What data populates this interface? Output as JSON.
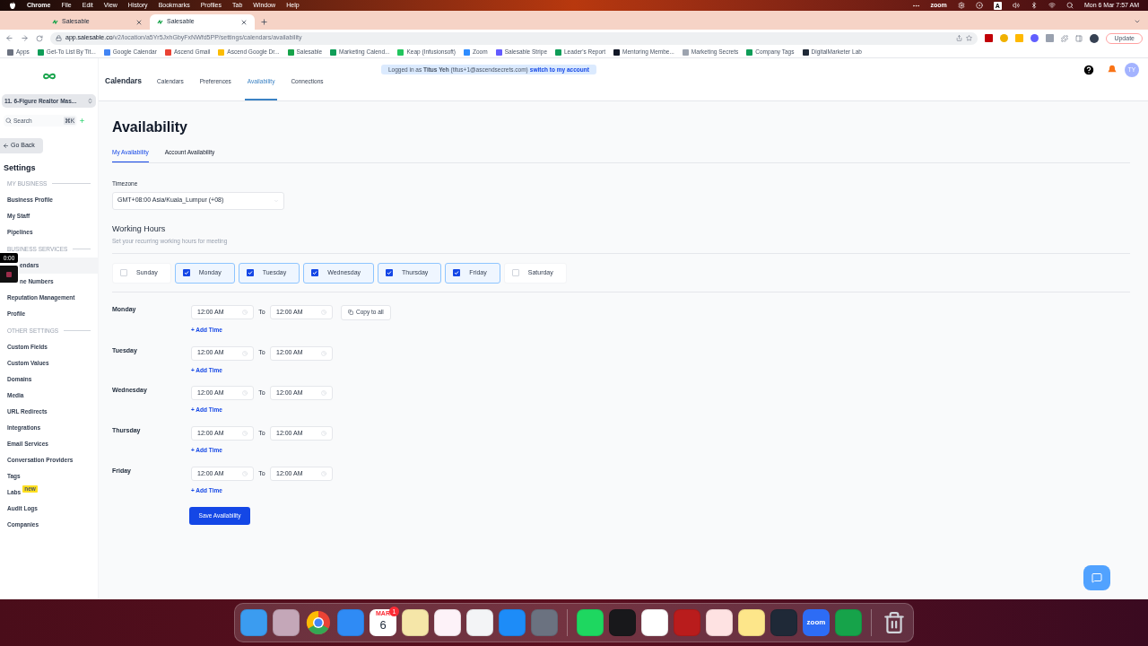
{
  "menubar": {
    "app": "Chrome",
    "menus": [
      "File",
      "Edit",
      "View",
      "History",
      "Bookmarks",
      "Profiles",
      "Tab",
      "Window",
      "Help"
    ],
    "zoom": "zoom",
    "input_source": "A",
    "clock": "Mon 6 Mar 7:57 AM"
  },
  "browser": {
    "tabs": [
      {
        "title": "Salesable",
        "selected": false
      },
      {
        "title": "Salesable",
        "selected": true
      }
    ],
    "url_host": "app.salesable.co",
    "url_path": "/v2/location/a5Yr5JxhGbyFxNWfd5PP/settings/calendars/availability",
    "update": "Update",
    "bookmarks": [
      {
        "label": "Apps",
        "color": "#6b7280"
      },
      {
        "label": "Get-To List By Tit...",
        "color": "#0f9d58"
      },
      {
        "label": "Google Calendar",
        "color": "#4285f4"
      },
      {
        "label": "Ascend Gmail",
        "color": "#ea4335"
      },
      {
        "label": "Ascend Google Dr...",
        "color": "#fbbc04"
      },
      {
        "label": "Salesable",
        "color": "#16a34a"
      },
      {
        "label": "Marketing Calend...",
        "color": "#0f9d58"
      },
      {
        "label": "Keap (Infusionsoft)",
        "color": "#22c55e"
      },
      {
        "label": "Zoom",
        "color": "#2d8cff"
      },
      {
        "label": "Salesable Stripe",
        "color": "#635bff"
      },
      {
        "label": "Leader's Report",
        "color": "#0f9d58"
      },
      {
        "label": "Mentoring Membe...",
        "color": "#111827"
      },
      {
        "label": "Marketing Secrets",
        "color": "#9ca3af"
      },
      {
        "label": "Company Tags",
        "color": "#0f9d58"
      },
      {
        "label": "DigitalMarketer Lab",
        "color": "#1f2937"
      }
    ]
  },
  "sidebar": {
    "account": "11. 6-Figure Realtor Mas...",
    "search": {
      "placeholder": "Search"
    },
    "shortcut": "⌘K",
    "back": "Go Back",
    "title": "Settings",
    "sections": [
      {
        "heading": "MY BUSINESS",
        "items": [
          {
            "label": "Business Profile",
            "selected": false
          },
          {
            "label": "My Staff",
            "selected": false
          },
          {
            "label": "Pipelines",
            "selected": false
          }
        ]
      },
      {
        "heading": "BUSINESS SERVICES",
        "items": [
          {
            "label": "endars",
            "selected": true,
            "covered": true
          },
          {
            "label": "ne Numbers",
            "selected": false,
            "covered": true
          },
          {
            "label": "Reputation Management",
            "selected": false
          },
          {
            "label": "Profile",
            "selected": false
          }
        ]
      },
      {
        "heading": "OTHER SETTINGS",
        "items": [
          {
            "label": "Custom Fields",
            "selected": false
          },
          {
            "label": "Custom Values",
            "selected": false
          },
          {
            "label": "Domains",
            "selected": false
          },
          {
            "label": "Media",
            "selected": false
          },
          {
            "label": "URL Redirects",
            "selected": false
          },
          {
            "label": "Integrations",
            "selected": false
          },
          {
            "label": "Email Services",
            "selected": false
          },
          {
            "label": "Conversation Providers",
            "selected": false
          },
          {
            "label": "Tags",
            "selected": false
          },
          {
            "label": "Labs",
            "selected": false,
            "badge": "new"
          },
          {
            "label": "Audit Logs",
            "selected": false
          },
          {
            "label": "Companies",
            "selected": false
          }
        ]
      }
    ]
  },
  "recorder": {
    "time": "0:00"
  },
  "header": {
    "title": "Calendars",
    "tabs": [
      {
        "label": "Calendars",
        "selected": false
      },
      {
        "label": "Preferences",
        "selected": false
      },
      {
        "label": "Availability",
        "selected": true
      },
      {
        "label": "Connections",
        "selected": false
      }
    ],
    "banner": {
      "text": "Logged in as **Titus Yeh** (titus+1@ascendsecrets.com)",
      "link": "switch to my account"
    },
    "avatar": "TY"
  },
  "page": {
    "title": "Availability",
    "subtabs": [
      {
        "label": "My Availability",
        "selected": true
      },
      {
        "label": "Account Availability",
        "selected": false
      }
    ],
    "timezone": {
      "label": "Timezone",
      "value": "GMT+08:00 Asia/Kuala_Lumpur (+08)"
    },
    "working_hours": {
      "title": "Working Hours",
      "subtitle": "Set your recurring working hours for meeting"
    },
    "days": [
      {
        "label": "Sunday",
        "checked": false
      },
      {
        "label": "Monday",
        "checked": true
      },
      {
        "label": "Tuesday",
        "checked": true
      },
      {
        "label": "Wednesday",
        "checked": true
      },
      {
        "label": "Thursday",
        "checked": true
      },
      {
        "label": "Friday",
        "checked": true
      },
      {
        "label": "Saturday",
        "checked": false
      }
    ],
    "schedule": [
      {
        "day": "Monday",
        "from": "12:00 AM",
        "to_label": "To",
        "to": "12:00 AM",
        "copy": "Copy to all",
        "add": "+ Add Time"
      },
      {
        "day": "Tuesday",
        "from": "12:00 AM",
        "to_label": "To",
        "to": "12:00 AM",
        "add": "+ Add Time"
      },
      {
        "day": "Wednesday",
        "from": "12:00 AM",
        "to_label": "To",
        "to": "12:00 AM",
        "add": "+ Add Time"
      },
      {
        "day": "Thursday",
        "from": "12:00 AM",
        "to_label": "To",
        "to": "12:00 AM",
        "add": "+ Add Time"
      },
      {
        "day": "Friday",
        "from": "12:00 AM",
        "to_label": "To",
        "to": "12:00 AM",
        "add": "+ Add Time"
      }
    ],
    "save": "Save Availability"
  },
  "dock": [
    {
      "kind": "app",
      "color": "#3b9cf0"
    },
    {
      "kind": "app",
      "color": "#c4a7b8"
    },
    {
      "kind": "chrome"
    },
    {
      "kind": "app",
      "color": "#2f8bf5"
    },
    {
      "kind": "calendar",
      "month": "MAR",
      "day": "6",
      "badge": "1"
    },
    {
      "kind": "app",
      "color": "#f5e6a8"
    },
    {
      "kind": "app",
      "color": "#fdf2f8"
    },
    {
      "kind": "app",
      "color": "#f3f4f6"
    },
    {
      "kind": "app",
      "color": "#1d8cf8"
    },
    {
      "kind": "app",
      "color": "#6b7280"
    },
    {
      "kind": "separator"
    },
    {
      "kind": "app",
      "color": "#1ed760"
    },
    {
      "kind": "app",
      "color": "#18181b"
    },
    {
      "kind": "app",
      "color": "#ffffff"
    },
    {
      "kind": "app",
      "color": "#b91c1c"
    },
    {
      "kind": "app",
      "color": "#fee2e2"
    },
    {
      "kind": "app",
      "color": "#fde68a"
    },
    {
      "kind": "app",
      "color": "#1f2937"
    },
    {
      "kind": "text",
      "color": "#2d6cf5",
      "label": "zoom"
    },
    {
      "kind": "app",
      "color": "#16a34a"
    },
    {
      "kind": "separator"
    },
    {
      "kind": "trash"
    }
  ]
}
